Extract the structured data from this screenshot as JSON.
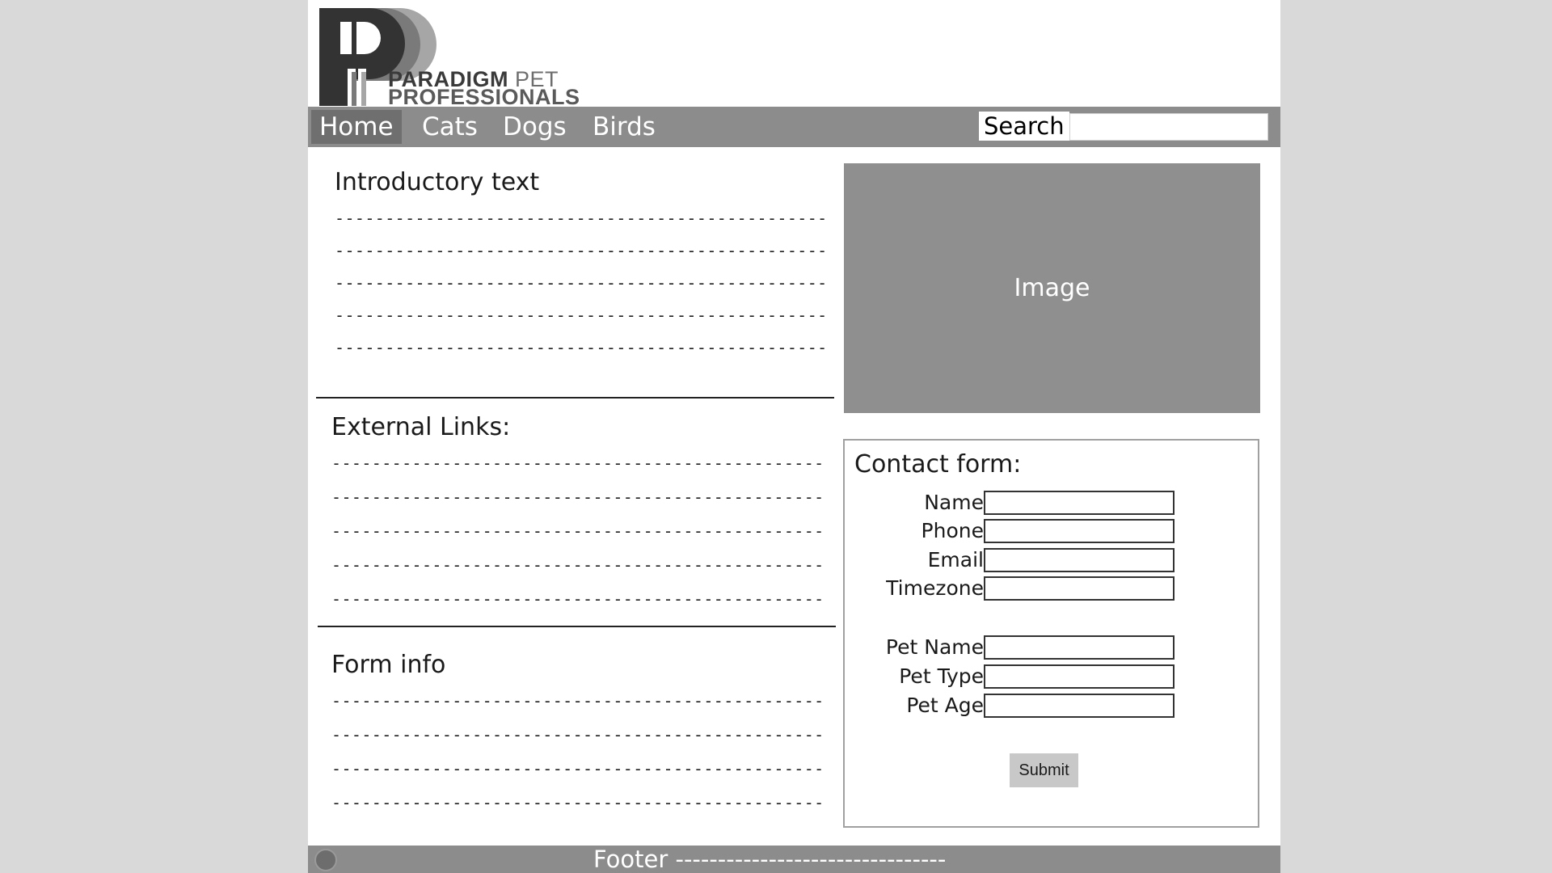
{
  "brand": {
    "line1_main": "PARADIGM",
    "line1_accent": "PET",
    "line2": "PROFESSIONALS",
    "logo_icon": "pp-logo-icon"
  },
  "nav": {
    "items": [
      {
        "label": "Home",
        "active": true
      },
      {
        "label": "Cats",
        "active": false
      },
      {
        "label": "Dogs",
        "active": false
      },
      {
        "label": "Birds",
        "active": false
      }
    ],
    "search_label": "Search",
    "search_value": ""
  },
  "intro": {
    "title": "Introductory text",
    "lines": [
      "------------------------------------------------------",
      "------------------------------------------------------",
      "------------------------------------------------------",
      "------------------------------------------------------",
      "------------------------------------------------------"
    ]
  },
  "links": {
    "title": "External Links:",
    "lines": [
      "------------------------------------------------------",
      "------------------------------------------------------",
      "------------------------------------------------------",
      "------------------------------------------------------",
      "------------------------------------------------------"
    ]
  },
  "form_info": {
    "title": "Form info",
    "lines": [
      "------------------------------------------------------",
      "------------------------------------------------------",
      "------------------------------------------------------",
      "------------------------------------------------------"
    ]
  },
  "image": {
    "label": "Image"
  },
  "contact_form": {
    "title": "Contact form:",
    "fields": {
      "name": "Name",
      "phone": "Phone",
      "email": "Email",
      "timezone": "Timezone",
      "pet_name": "Pet Name",
      "pet_type": "Pet Type",
      "pet_age": "Pet Age"
    },
    "submit_label": "Submit"
  },
  "footer": {
    "text": "Footer --------------------------------",
    "icon": "settings-icon"
  },
  "colors": {
    "page_bg": "#d9d9d9",
    "nav_bg": "#8c8c8c",
    "nav_active": "#6f6f6f",
    "image_bg": "#8f8f8f"
  }
}
